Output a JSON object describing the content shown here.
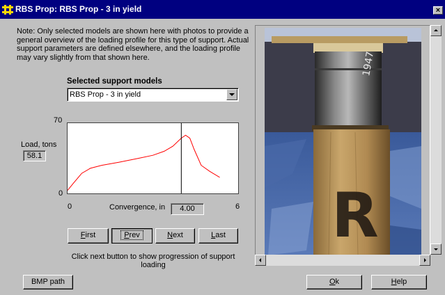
{
  "window": {
    "title": "RBS Prop: RBS Prop - 3 in yield",
    "close_glyph": "×"
  },
  "note": "Note:  Only selected models are shown here with photos to provide a general overview of the loading profile for this type of support.  Actual support parameters are defined elsewhere, and the loading profile may vary slightly from that shown here.",
  "models": {
    "label": "Selected support models",
    "selected": "RBS Prop - 3 in yield"
  },
  "chart_data": {
    "type": "line",
    "xlabel": "Convergence, in",
    "ylabel": "Load, tons",
    "xlim": [
      0,
      6
    ],
    "ylim": [
      0,
      70
    ],
    "x_ticks": [
      "0",
      "6"
    ],
    "y_ticks": [
      "70",
      "0"
    ],
    "series": [
      {
        "color": "#ff0000",
        "x": [
          0.0,
          0.2,
          0.5,
          0.8,
          1.2,
          1.8,
          2.5,
          3.0,
          3.4,
          3.7,
          4.0,
          4.15,
          4.3,
          4.45,
          4.7,
          5.0,
          5.35
        ],
        "y": [
          3,
          10,
          20,
          25,
          28,
          31,
          35,
          38,
          42,
          47,
          55,
          58,
          55,
          44,
          28,
          22,
          16
        ]
      }
    ],
    "cursor_x": 4.0
  },
  "readouts": {
    "load_value": "58.1",
    "convergence_value": "4.00"
  },
  "nav_buttons": [
    {
      "mnemonic": "F",
      "rest": "irst"
    },
    {
      "mnemonic": "P",
      "rest": "rev"
    },
    {
      "mnemonic": "N",
      "rest": "ext"
    },
    {
      "mnemonic": "L",
      "rest": "ast"
    }
  ],
  "hint": "Click next button to show progression of support loading",
  "footer": {
    "bmp_label": "BMP path",
    "ok_mnemonic": "O",
    "ok_rest": "k",
    "help_mnemonic": "H",
    "help_rest": "elp"
  },
  "photo": {
    "marking": "R",
    "stamp": "1947"
  },
  "colors": {
    "titlebar": "#000080",
    "face": "#c0c0c0",
    "curve": "#ff0000"
  },
  "icons": [
    "app-icon",
    "close-icon",
    "dropdown-arrow-icon",
    "scroll-up-icon",
    "scroll-down-icon",
    "scroll-left-icon",
    "scroll-right-icon"
  ]
}
